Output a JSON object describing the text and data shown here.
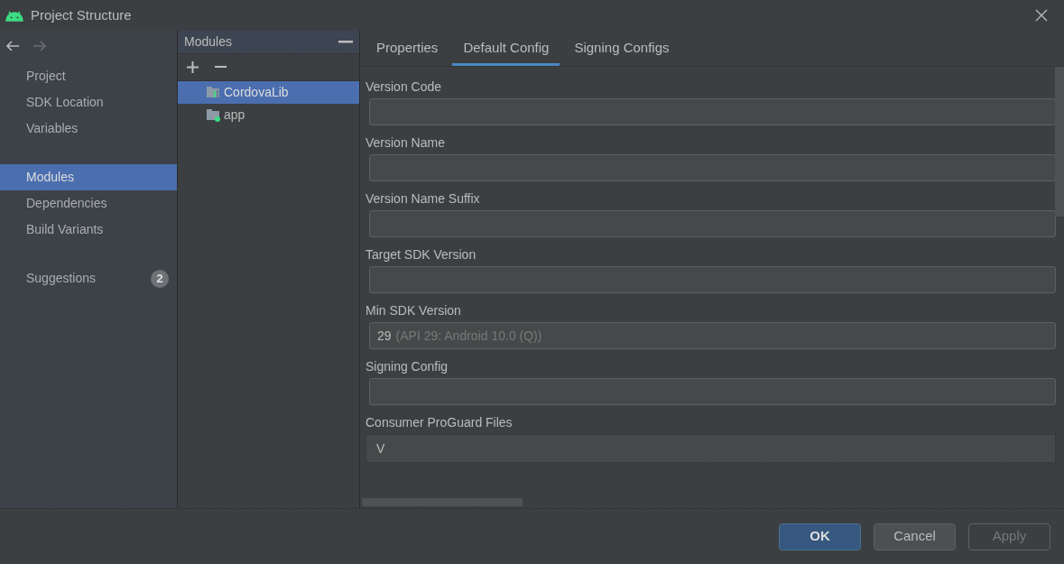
{
  "window": {
    "title": "Project Structure"
  },
  "sidebar": {
    "groups": [
      {
        "items": [
          {
            "label": "Project",
            "selected": false
          },
          {
            "label": "SDK Location",
            "selected": false
          },
          {
            "label": "Variables",
            "selected": false
          }
        ]
      },
      {
        "items": [
          {
            "label": "Modules",
            "selected": true
          },
          {
            "label": "Dependencies",
            "selected": false
          },
          {
            "label": "Build Variants",
            "selected": false
          }
        ]
      },
      {
        "items": [
          {
            "label": "Suggestions",
            "selected": false,
            "badge": "2"
          }
        ]
      }
    ]
  },
  "modules": {
    "title": "Modules",
    "items": [
      {
        "label": "CordovaLib",
        "kind": "library",
        "selected": true
      },
      {
        "label": "app",
        "kind": "app",
        "selected": false
      }
    ]
  },
  "tabs": [
    {
      "label": "Properties",
      "selected": false
    },
    {
      "label": "Default Config",
      "selected": true
    },
    {
      "label": "Signing Configs",
      "selected": false
    }
  ],
  "fields": [
    {
      "label": "Version Code",
      "kind": "text"
    },
    {
      "label": "Version Name",
      "kind": "text"
    },
    {
      "label": "Version Name Suffix",
      "kind": "text"
    },
    {
      "label": "Target SDK Version",
      "kind": "text"
    },
    {
      "label": "Min SDK Version",
      "kind": "combo",
      "value": "29",
      "hint": "(API 29: Android 10.0 (Q))"
    },
    {
      "label": "Signing Config",
      "kind": "text"
    },
    {
      "label": "Consumer ProGuard Files",
      "kind": "list",
      "value": "V"
    }
  ],
  "buttons": [
    {
      "label": "OK",
      "default": true,
      "disabled": false
    },
    {
      "label": "Cancel",
      "default": false,
      "disabled": false
    },
    {
      "label": "Apply",
      "default": false,
      "disabled": true
    }
  ]
}
